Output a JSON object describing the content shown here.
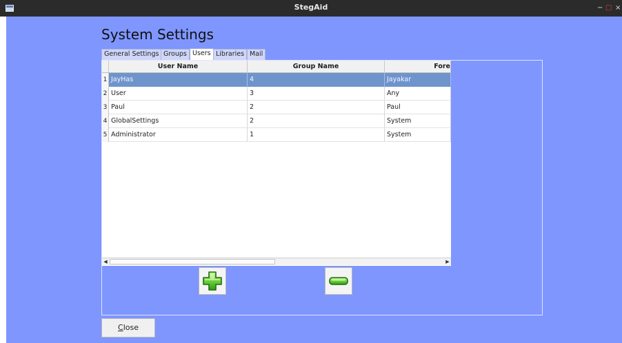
{
  "window": {
    "title": "StegAid",
    "controls": [
      "−",
      "□",
      "×"
    ]
  },
  "page": {
    "title": "System Settings"
  },
  "tabs": [
    {
      "label": "General Settings",
      "active": false
    },
    {
      "label": "Groups",
      "active": false
    },
    {
      "label": "Users",
      "active": true
    },
    {
      "label": "Libraries",
      "active": false
    },
    {
      "label": "Mail",
      "active": false
    }
  ],
  "table": {
    "columns": [
      "User Name",
      "Group Name",
      "Fore"
    ],
    "rows": [
      {
        "num": "1",
        "user": "JayHas",
        "group": "4",
        "fore": "Jayakar",
        "selected": true
      },
      {
        "num": "2",
        "user": "User",
        "group": "3",
        "fore": "Any",
        "selected": false
      },
      {
        "num": "3",
        "user": "Paul",
        "group": "2",
        "fore": "Paul",
        "selected": false
      },
      {
        "num": "4",
        "user": "GlobalSettings",
        "group": "2",
        "fore": "System",
        "selected": false
      },
      {
        "num": "5",
        "user": "Administrator",
        "group": "1",
        "fore": "System",
        "selected": false
      }
    ]
  },
  "buttons": {
    "add_icon": "plus-icon",
    "remove_icon": "minus-icon",
    "close_label_mnemonic": "C",
    "close_label_rest": "lose"
  },
  "colors": {
    "background": "#7f96fe",
    "selection": "#6f94cc"
  }
}
